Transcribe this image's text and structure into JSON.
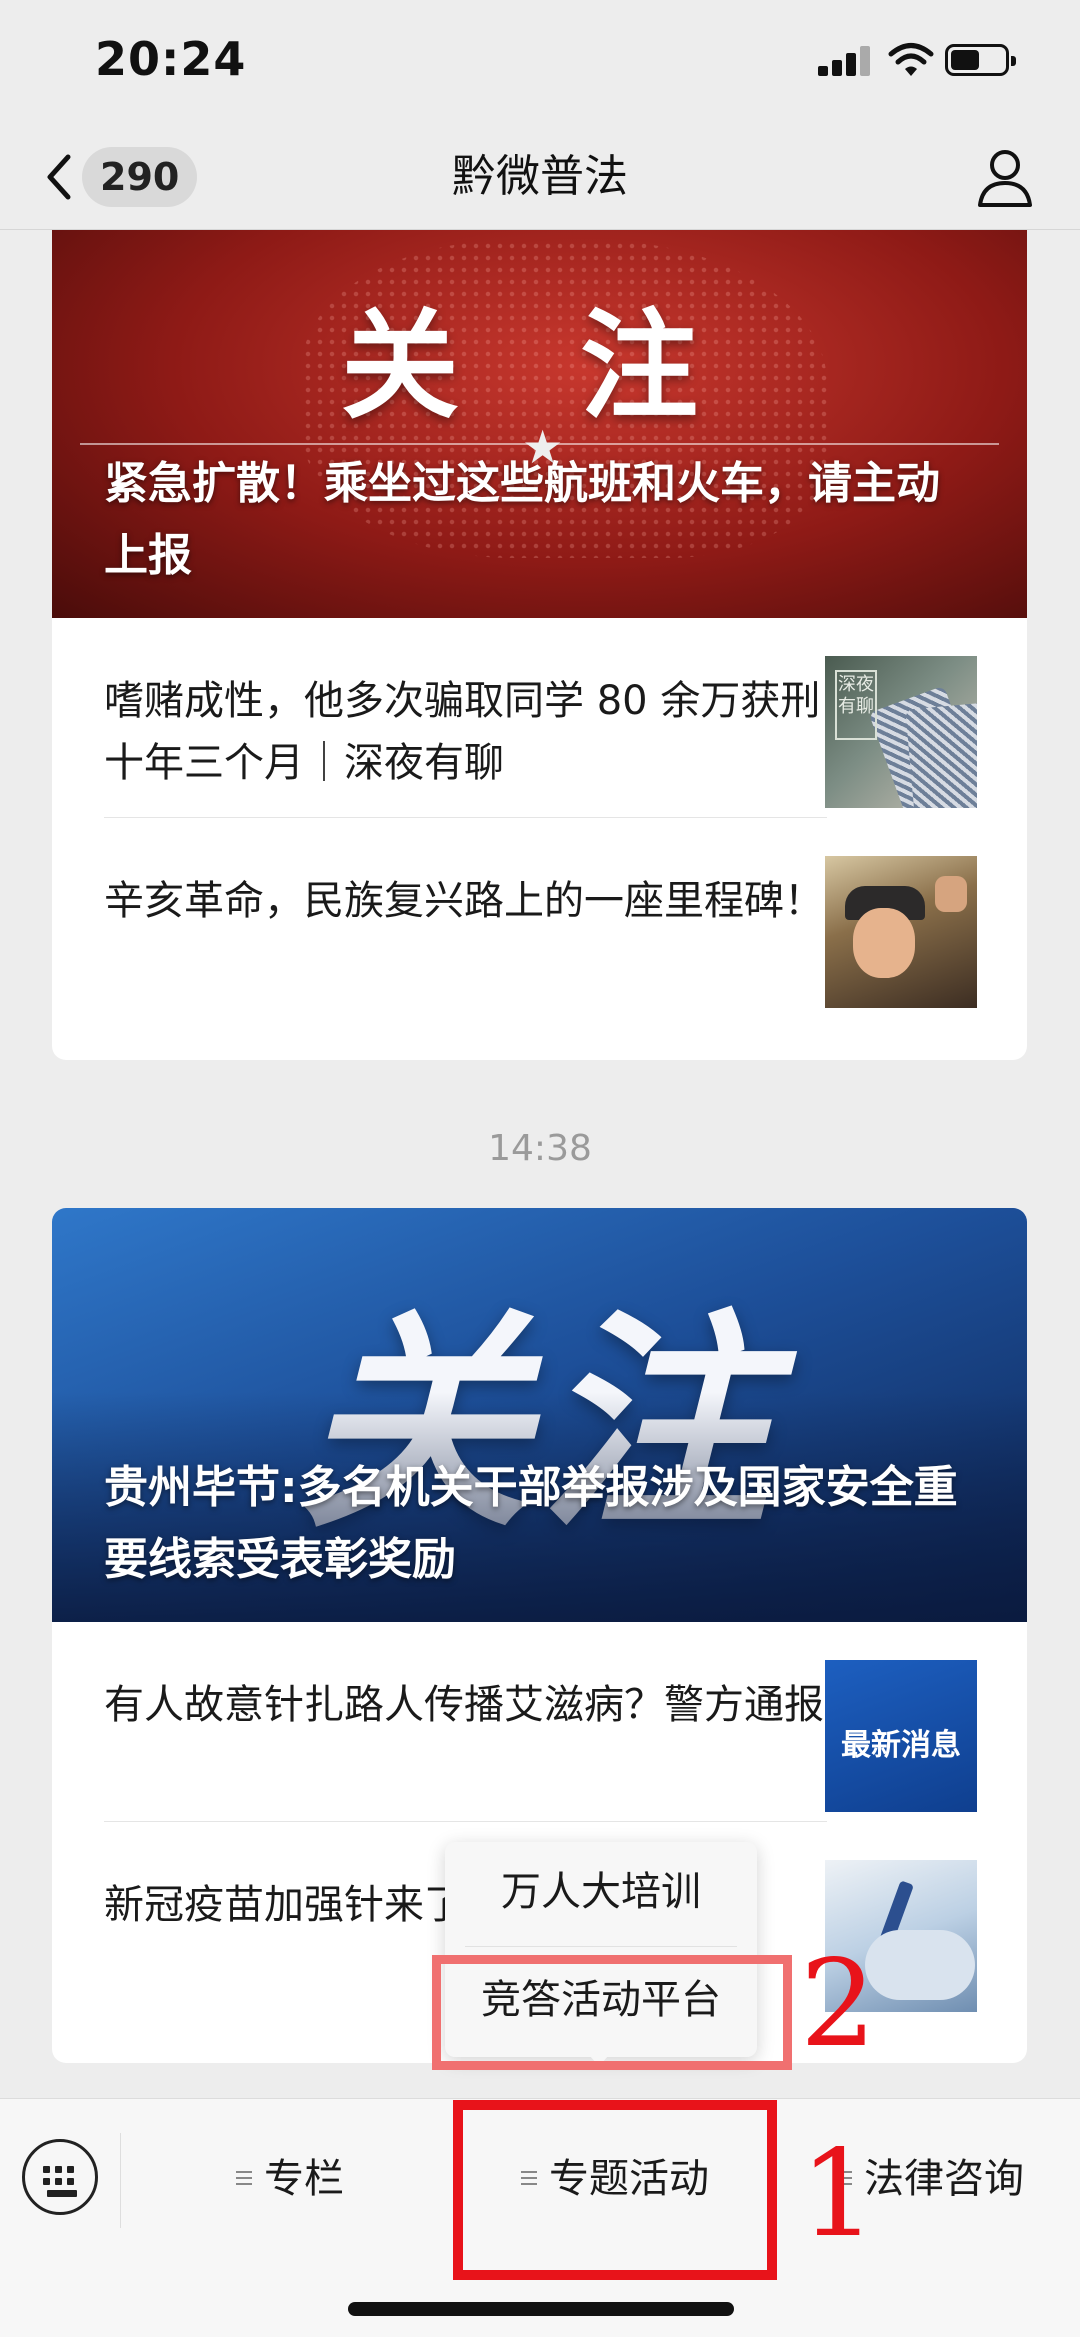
{
  "status_bar": {
    "time": "20:24"
  },
  "nav": {
    "unread_count": "290",
    "title": "黔微普法"
  },
  "articles_group_1": {
    "hero": {
      "overlay_text": "关 注",
      "title": "紧急扩散！乘坐过这些航班和火车，请主动上报"
    },
    "items": [
      {
        "title": "嗜赌成性，他多次骗取同学 80 余万获刑十年三个月｜深夜有聊",
        "thumb_label": "深夜有聊"
      },
      {
        "title": "辛亥革命，民族复兴路上的一座里程碑！"
      }
    ]
  },
  "timestamp": "14:38",
  "articles_group_2": {
    "hero": {
      "overlay_text": "关注",
      "title": "贵州毕节:多名机关干部举报涉及国家安全重要线索受表彰奖励"
    },
    "items": [
      {
        "title": "有人故意针扎路人传播艾滋病？警方通报",
        "thumb_text": "最新消息"
      },
      {
        "title": "新冠疫苗加强针来了！这些人可以打"
      }
    ]
  },
  "popup_menu": {
    "items": [
      "万人大培训",
      "竞答活动平台"
    ]
  },
  "bottom_menu": {
    "items": [
      "专栏",
      "专题活动",
      "法律咨询"
    ]
  },
  "annotations": {
    "step1": "1",
    "step2": "2"
  },
  "colors": {
    "annotation_red": "#e8131a",
    "background": "#ededed"
  }
}
